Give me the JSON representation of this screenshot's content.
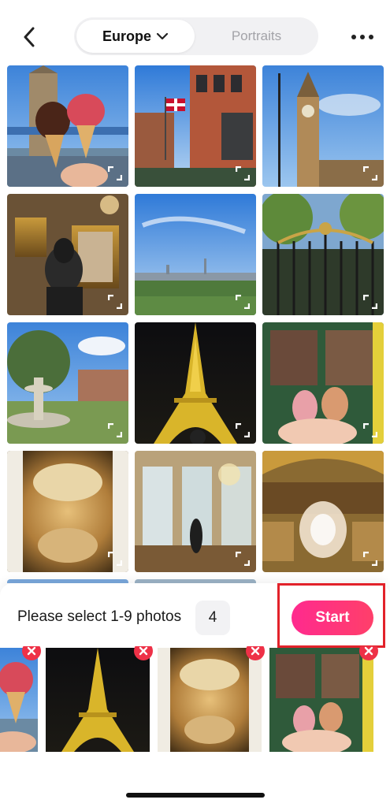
{
  "header": {
    "back_icon": "chevron-left-icon",
    "tabs": [
      {
        "label": "Europe",
        "selected": true,
        "icon": "chevron-down-icon"
      },
      {
        "label": "Portraits",
        "selected": false
      }
    ],
    "more_icon": "more-horizontal-icon"
  },
  "grid": {
    "photos": [
      {
        "subject": "ice cream cones with Tower Bridge"
      },
      {
        "subject": "London street with Union Jack flag"
      },
      {
        "subject": "Big Ben clock tower"
      },
      {
        "subject": "mirror selfie in palace gallery"
      },
      {
        "subject": "London skyline from park"
      },
      {
        "subject": "ornate black and gold gate"
      },
      {
        "subject": "fountain at Place des Vosges"
      },
      {
        "subject": "Eiffel Tower lit at night"
      },
      {
        "subject": "macarons held in front of shop"
      },
      {
        "subject": "painted palace ceiling"
      },
      {
        "subject": "Hall of Mirrors"
      },
      {
        "subject": "crystal chandelier in gilded room"
      }
    ],
    "expand_icon": "expand-icon"
  },
  "selection": {
    "hint": "Please select 1-9 photos",
    "count": "4",
    "start_label": "Start",
    "accent_from": "#ff2a8e",
    "accent_to": "#ff3f6a",
    "highlight_color": "#e2222a",
    "remove_color": "#ee3147",
    "remove_icon": "close-icon"
  }
}
